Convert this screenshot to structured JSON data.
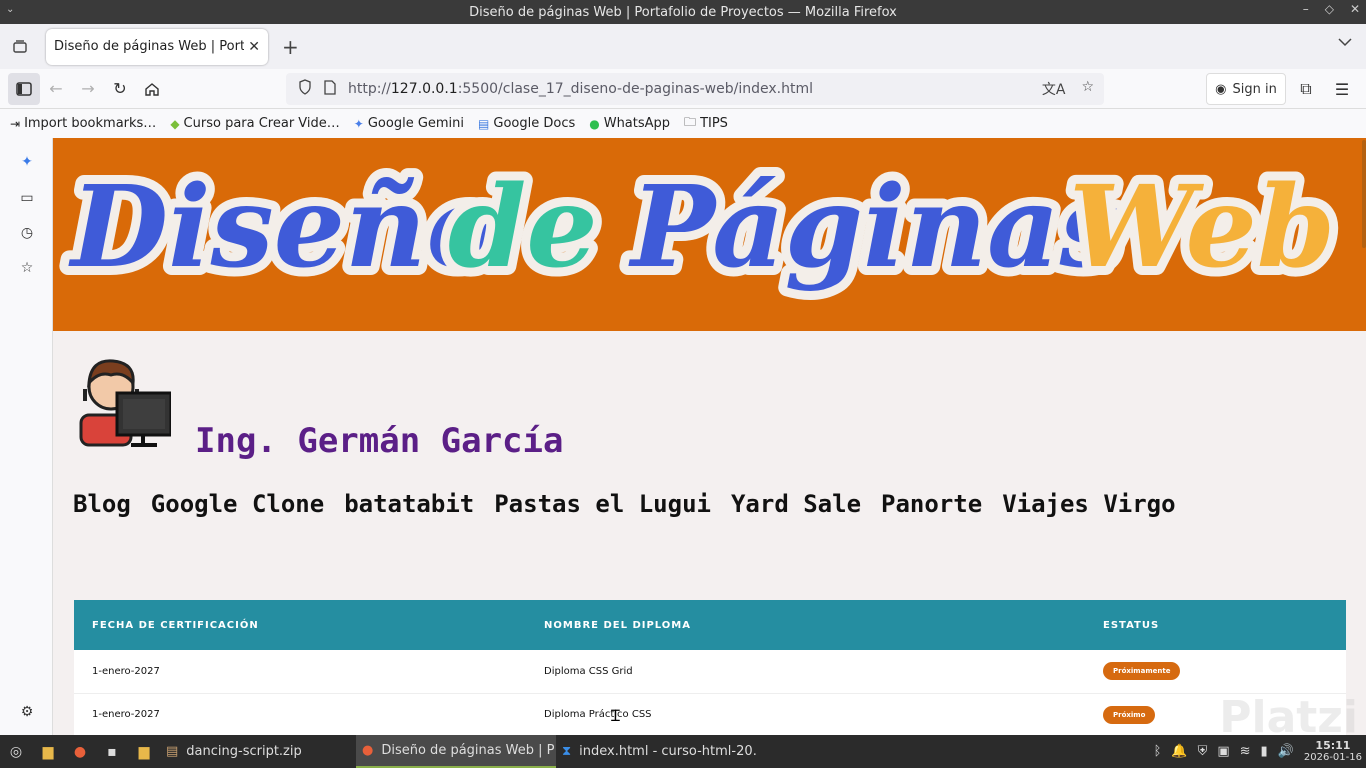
{
  "window": {
    "title": "Diseño de páginas Web | Portafolio de Proyectos — Mozilla Firefox"
  },
  "tabs": [
    {
      "title": "Diseño de páginas Web | Portafolio de Proyectos"
    }
  ],
  "navbar": {
    "url_prefix": "http://",
    "url_host": "127.0.0.1",
    "url_rest": ":5500/clase_17_diseno-de-paginas-web/index.html",
    "signin_label": "Sign in"
  },
  "bookmarks": [
    {
      "label": "Import bookmarks…",
      "icon": "import-icon"
    },
    {
      "label": "Curso para Crear Vide…",
      "icon": "course-icon"
    },
    {
      "label": "Google Gemini",
      "icon": "gemini-icon"
    },
    {
      "label": "Google Docs",
      "icon": "docs-icon"
    },
    {
      "label": "WhatsApp",
      "icon": "whatsapp-icon"
    },
    {
      "label": "TIPS",
      "icon": "folder-icon"
    }
  ],
  "page": {
    "banner_words": [
      "Diseño",
      "de",
      "Páginas",
      "Web"
    ],
    "person_name": "Ing. Germán García",
    "projects": [
      "Blog",
      "Google Clone",
      "batatabit",
      "Pastas el Lugui",
      "Yard Sale",
      "Panorte",
      "Viajes Virgo"
    ],
    "table": {
      "headers": [
        "FECHA DE CERTIFICACIÓN",
        "NOMBRE DEL DIPLOMA",
        "ESTATUS"
      ],
      "rows": [
        {
          "fecha": "1-enero-2027",
          "diploma": "Diploma CSS Grid",
          "estatus": "Próximamente"
        },
        {
          "fecha": "1-enero-2027",
          "diploma": "Diploma Práctico CSS",
          "estatus": "Próximo"
        }
      ]
    },
    "watermark": "Platzi"
  },
  "taskbar": {
    "tasks": [
      {
        "label": "dancing-script.zip",
        "active": false
      },
      {
        "label": "Diseño de páginas Web | P…",
        "active": true
      },
      {
        "label": "index.html - curso-html-20…",
        "active": false
      }
    ],
    "time": "15:11",
    "date": "2026-01-16"
  },
  "colors": {
    "banner": "#d96a08",
    "table_header": "#258ea1",
    "name": "#5b1f87",
    "badge": "#d66a10"
  }
}
